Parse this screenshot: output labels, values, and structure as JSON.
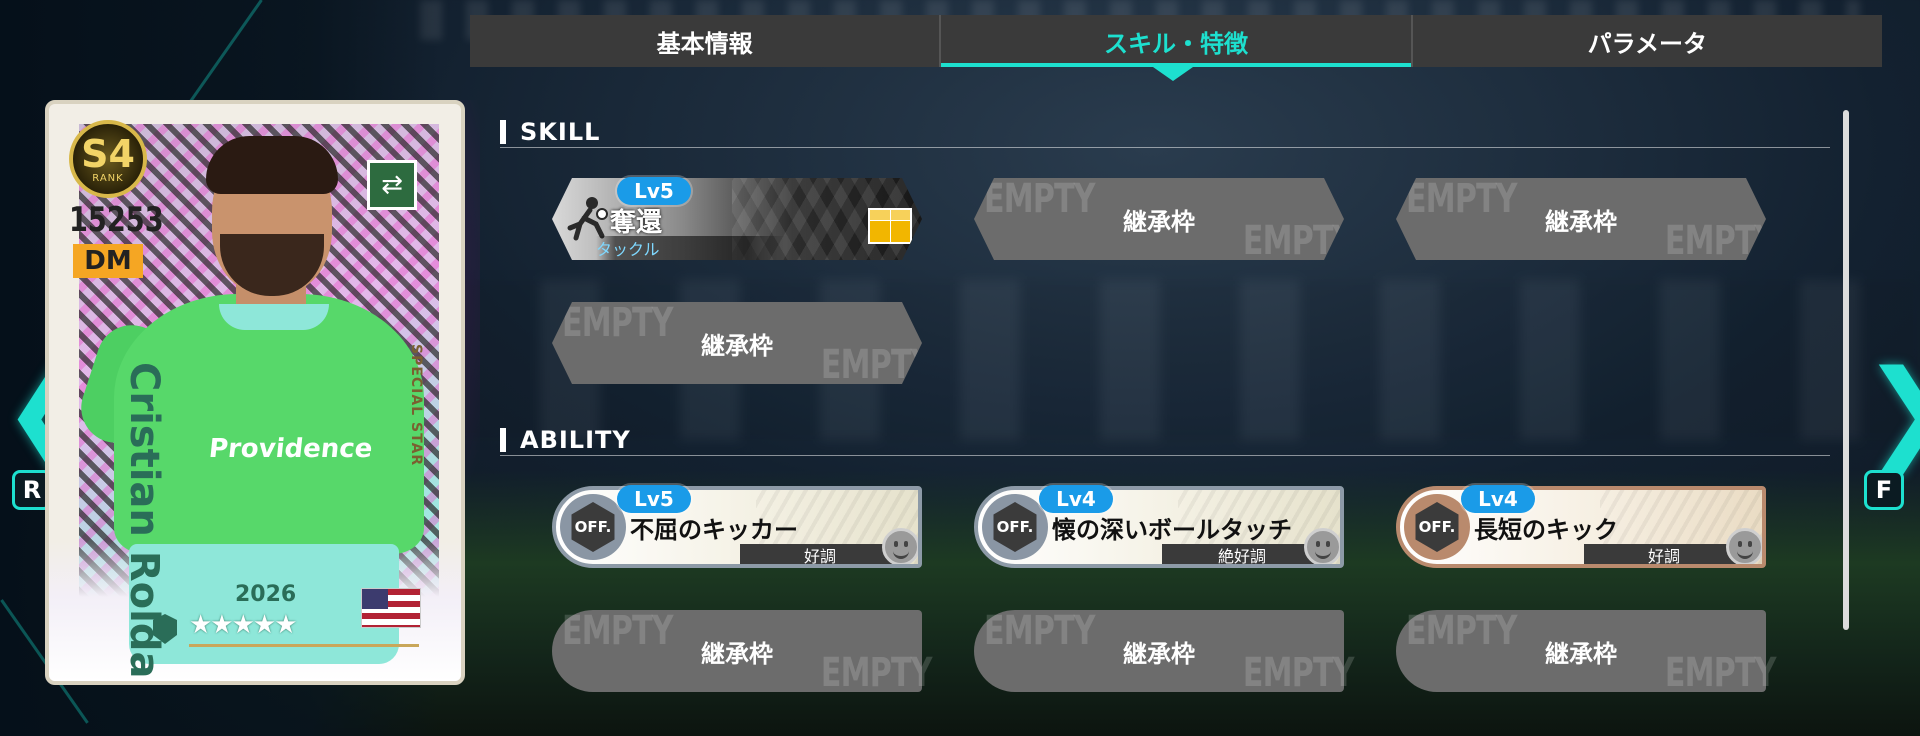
{
  "tabs": [
    {
      "label": "基本情報",
      "active": false
    },
    {
      "label": "スキル・特徴",
      "active": true
    },
    {
      "label": "パラメータ",
      "active": false
    }
  ],
  "skill_section": {
    "title": "SKILL",
    "filled": {
      "level": "Lv5",
      "name": "奪還",
      "category": "タックル",
      "icon": "tackle-icon"
    },
    "empty_slots": [
      {
        "label": "継承枠",
        "watermark": "EMPTY"
      },
      {
        "label": "継承枠",
        "watermark": "EMPTY"
      },
      {
        "label": "継承枠",
        "watermark": "EMPTY"
      }
    ]
  },
  "ability_section": {
    "title": "ABILITY",
    "abilities": [
      {
        "badge": "OFF.",
        "level": "Lv5",
        "name": "不屈のキッカー",
        "condition": "好調",
        "tier": "silver"
      },
      {
        "badge": "OFF.",
        "level": "Lv4",
        "name": "懐の深いボールタッチ",
        "condition": "絶好調",
        "tier": "silver"
      },
      {
        "badge": "OFF.",
        "level": "Lv4",
        "name": "長短のキック",
        "condition": "好調",
        "tier": "bronze"
      }
    ],
    "empty_slots": [
      {
        "label": "継承枠",
        "watermark": "EMPTY"
      },
      {
        "label": "継承枠",
        "watermark": "EMPTY"
      },
      {
        "label": "継承枠",
        "watermark": "EMPTY"
      }
    ]
  },
  "nav": {
    "left_key": "R",
    "right_key": "F",
    "left_arrow": "❮",
    "right_arrow": "❯"
  },
  "card": {
    "rank": "S4",
    "rank_label": "RANK",
    "rating": "15253",
    "position": "DM",
    "player_name": "Cristian Roldan",
    "card_type": "SPECIAL STAR",
    "year": "2026",
    "stars": "★★★★★",
    "sponsor": "Providence",
    "nationality_flag": "us-flag",
    "colors": {
      "accent": "#1de0cf",
      "level_badge": "#1a9be8",
      "position_badge": "#f5a623"
    }
  }
}
